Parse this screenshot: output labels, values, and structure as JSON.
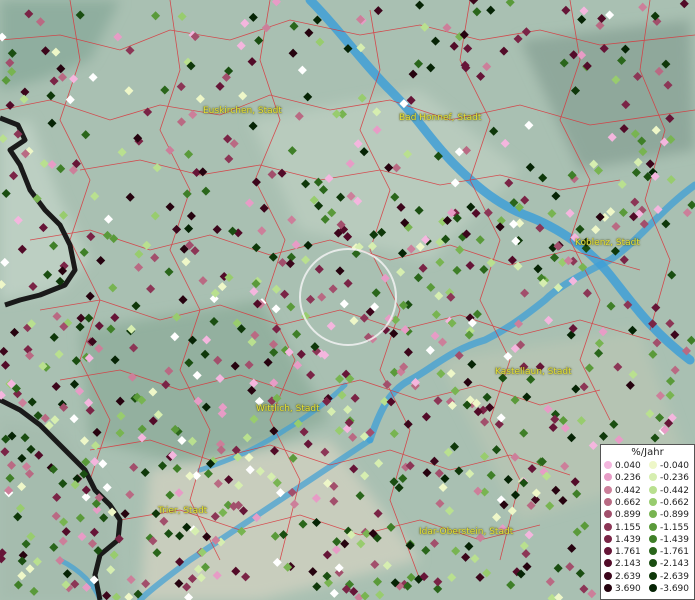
{
  "map": {
    "place_labels": [
      {
        "key": "euskirchen",
        "text": "Euskirchen, Stadt"
      },
      {
        "key": "bad-honnef",
        "text": "Bad Honnef, Stadt"
      },
      {
        "key": "koblenz",
        "text": "Koblenz, Stadt"
      },
      {
        "key": "kastellaun",
        "text": "Kastellaun, Stadt"
      },
      {
        "key": "wittlich",
        "text": "Wittlich, Stadt"
      },
      {
        "key": "trier",
        "text": "Trier, Stadt"
      },
      {
        "key": "idar-oberstein",
        "text": "Idar-Oberstein, Stadt"
      }
    ],
    "legend": {
      "title": "%/Jahr",
      "positive": [
        {
          "label": "0.040",
          "color": "#f4b6de"
        },
        {
          "label": "0.236",
          "color": "#e79cc6"
        },
        {
          "label": "0.442",
          "color": "#cc7f9a"
        },
        {
          "label": "0.662",
          "color": "#b96a83"
        },
        {
          "label": "0.899",
          "color": "#a24f6c"
        },
        {
          "label": "1.155",
          "color": "#8c3656"
        },
        {
          "label": "1.439",
          "color": "#7a2446"
        },
        {
          "label": "1.761",
          "color": "#661537"
        },
        {
          "label": "2.143",
          "color": "#520b28"
        },
        {
          "label": "2.639",
          "color": "#3c061b"
        },
        {
          "label": "3.690",
          "color": "#26030f"
        }
      ],
      "negative": [
        {
          "label": "-0.040",
          "color": "#eef7c8"
        },
        {
          "label": "-0.236",
          "color": "#d6eeb0"
        },
        {
          "label": "-0.442",
          "color": "#b9e08f"
        },
        {
          "label": "-0.662",
          "color": "#98cc6e"
        },
        {
          "label": "-0.899",
          "color": "#78b451"
        },
        {
          "label": "-1.155",
          "color": "#5a9a3a"
        },
        {
          "label": "-1.439",
          "color": "#3f7f28"
        },
        {
          "label": "-1.761",
          "color": "#2a661b"
        },
        {
          "label": "-2.143",
          "color": "#1a4e11"
        },
        {
          "label": "-2.639",
          "color": "#0f380a"
        },
        {
          "label": "-3.690",
          "color": "#062405"
        }
      ]
    },
    "colors": {
      "terrain": "#9db5a8",
      "boundary": "#d9363c",
      "river": "#3f9fd6",
      "state_border": "#1a1a1a",
      "label": "#e6e23a"
    }
  }
}
